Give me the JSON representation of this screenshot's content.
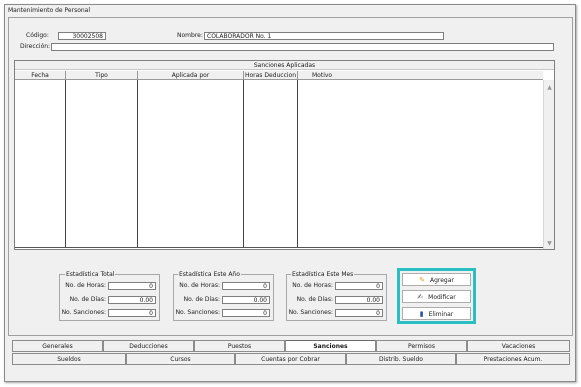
{
  "window": {
    "title": "Mantenimiento de Personal"
  },
  "form": {
    "codigo_label": "Código:",
    "codigo_value": "30002508",
    "nombre_label": "Nombre:",
    "nombre_value": "COLABORADOR No. 1",
    "direccion_label": "Dirección:",
    "direccion_value": ""
  },
  "grid": {
    "title": "Sanciones Aplicadas",
    "columns": [
      "Fecha",
      "Tipo",
      "Aplicada por",
      "Horas Deduccion",
      "Motivo"
    ],
    "rows": []
  },
  "stats": [
    {
      "title": "Estadística Total",
      "horas_label": "No. de Horas:",
      "horas_value": "0",
      "dias_label": "No. de Días:",
      "dias_value": "0.00",
      "sanciones_label": "No. Sanciones:",
      "sanciones_value": "0"
    },
    {
      "title": "Estadística Este Año",
      "horas_label": "No. de Horas:",
      "horas_value": "0",
      "dias_label": "No. de Días:",
      "dias_value": "0.00",
      "sanciones_label": "No. Sanciones:",
      "sanciones_value": "0"
    },
    {
      "title": "Estadística Este Mes",
      "horas_label": "No. de Horas:",
      "horas_value": "0",
      "dias_label": "No. de Días:",
      "dias_value": "0.00",
      "sanciones_label": "No. Sanciones:",
      "sanciones_value": "0"
    }
  ],
  "buttons": {
    "agregar": "Agregar",
    "modificar": "Modificar",
    "eliminar": "Eliminar"
  },
  "tabs_row1": [
    "Generales",
    "Deducciones",
    "Puestos",
    "Sanciones",
    "Permisos",
    "Vacaciones"
  ],
  "tabs_row2": [
    "Sueldos",
    "Cursos",
    "Cuentas por Cobrar",
    "Distrib. Sueldo",
    "Prestaciones Acum."
  ],
  "selected_tab": "Sanciones",
  "icons": {
    "agregar": "pencil-icon",
    "modificar": "edit-note-icon",
    "eliminar": "trash-icon",
    "scroll_up": "scroll-up-arrow-icon",
    "scroll_down": "scroll-down-arrow-icon"
  },
  "colors": {
    "highlight": "#2bbfc4",
    "window_bg": "#f0f0f0"
  }
}
